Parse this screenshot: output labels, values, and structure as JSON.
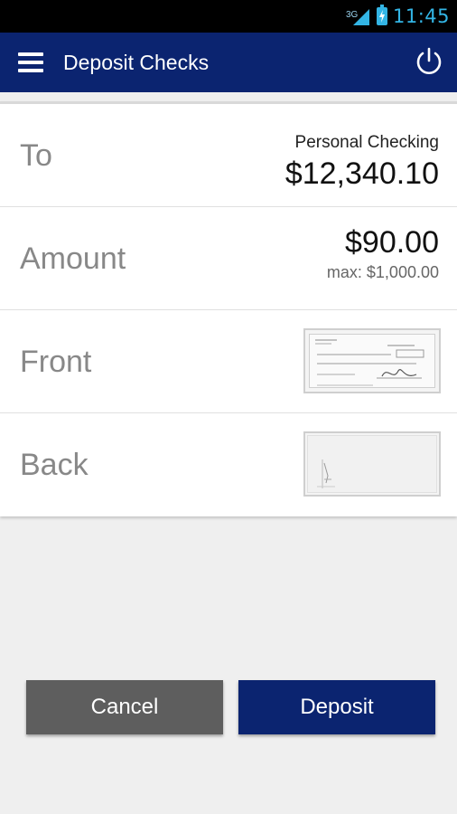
{
  "status_bar": {
    "network": "3G",
    "time": "11:45",
    "icons": [
      "signal-icon",
      "battery-charging-icon"
    ],
    "accent_color": "#33b5e5"
  },
  "app_bar": {
    "title": "Deposit Checks",
    "icons": [
      "menu-icon",
      "power-icon"
    ],
    "background": "#0b2470"
  },
  "rows": {
    "to": {
      "label": "To",
      "account": "Personal Checking",
      "balance": "$12,340.10"
    },
    "amount": {
      "label": "Amount",
      "value": "$90.00",
      "max": "max: $1,000.00"
    },
    "front": {
      "label": "Front"
    },
    "back": {
      "label": "Back"
    }
  },
  "buttons": {
    "cancel": "Cancel",
    "deposit": "Deposit"
  }
}
